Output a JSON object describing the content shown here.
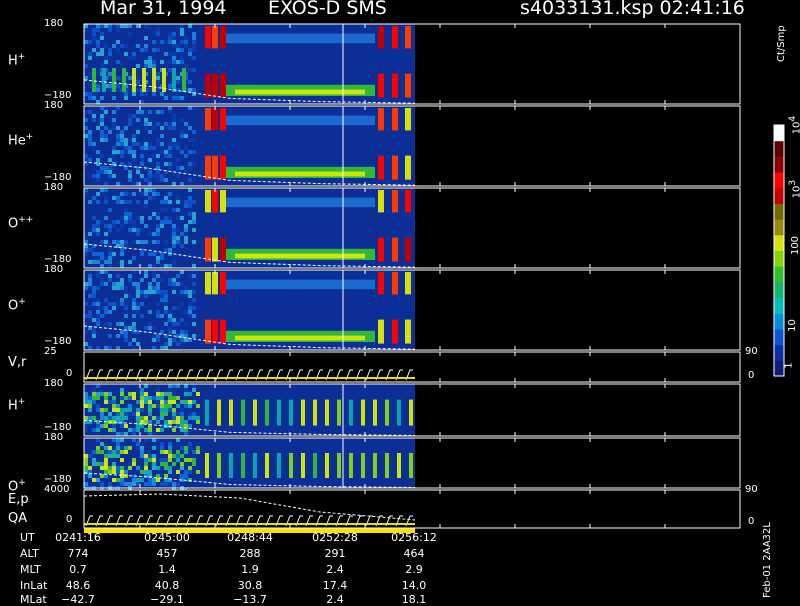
{
  "header": {
    "date": "Mar 31, 1994",
    "mission": "EXOS-D SMS",
    "file_time": "s4033131.ksp  02:41:16"
  },
  "colorbar": {
    "label": "Ct/Smp",
    "ticks": [
      "1",
      "10",
      "100",
      "10",
      "10"
    ],
    "tick_sups": [
      "",
      "",
      "",
      "3",
      "4"
    ],
    "colors": [
      "#0b1f7a",
      "#0c2fa6",
      "#0b55d3",
      "#0090d8",
      "#00c0c0",
      "#14b46e",
      "#2fc02c",
      "#86d40e",
      "#d6e40b",
      "#9a8a08",
      "#6f6a06",
      "#c00000",
      "#ff0000",
      "#8a0000",
      "#5a0000",
      "#ffffff"
    ]
  },
  "footer": {
    "stamp": "Feb-01 2AA32L"
  },
  "panels": [
    {
      "label": "H",
      "sup": "+",
      "ymax": "180",
      "ymin": "−180"
    },
    {
      "label": "He",
      "sup": "+",
      "ymax": "180",
      "ymin": "−180"
    },
    {
      "label": "O",
      "sup": "++",
      "ymax": "180",
      "ymin": "−180"
    },
    {
      "label": "O",
      "sup": "+",
      "ymax": "180",
      "ymin": "−180"
    },
    {
      "label": "V,r",
      "sup": "",
      "ymax": "25",
      "ymin": "0",
      "right_top": "90",
      "right_bot": "0"
    },
    {
      "label": "H",
      "sup": "+",
      "ymax": "180",
      "ymin": "−180"
    },
    {
      "label": "O",
      "sup": "+",
      "ymax": "180",
      "ymin": "−180"
    },
    {
      "label": "E,p",
      "label2": "QA",
      "sup": "",
      "ymax": "4000",
      "ymin": "0",
      "right_top": "90",
      "right_bot": "0"
    }
  ],
  "info_table": {
    "row_labels": [
      "UT",
      "ALT",
      "MLT",
      "InLat",
      "MLat"
    ],
    "columns": [
      [
        "0241:16",
        "774",
        "0.7",
        "48.6",
        "−42.7"
      ],
      [
        "0245:00",
        "457",
        "1.4",
        "40.8",
        "−29.1"
      ],
      [
        "0248:44",
        "288",
        "1.9",
        "30.8",
        "−13.7"
      ],
      [
        "0252:28",
        "291",
        "2.4",
        "17.4",
        "2.4"
      ],
      [
        "0256:12",
        "464",
        "2.9",
        "14.0",
        "18.1"
      ]
    ]
  },
  "chart_data": {
    "type": "heatmap",
    "x_ticks_ut": [
      "0241:16",
      "0245:00",
      "0248:44",
      "0252:28",
      "0256:12"
    ],
    "colorbar_scale": "log",
    "colorbar_range": [
      1,
      10000
    ],
    "panels": [
      {
        "name": "H+",
        "yrange": [
          -180,
          180
        ]
      },
      {
        "name": "He+",
        "yrange": [
          -180,
          180
        ]
      },
      {
        "name": "O++",
        "yrange": [
          -180,
          180
        ]
      },
      {
        "name": "O+",
        "yrange": [
          -180,
          180
        ]
      },
      {
        "name": "V,r",
        "yrange": [
          0,
          25
        ],
        "y2range": [
          0,
          90
        ]
      },
      {
        "name": "H+",
        "yrange": [
          -180,
          180
        ]
      },
      {
        "name": "O+",
        "yrange": [
          -180,
          180
        ]
      },
      {
        "name": "E,p QA",
        "yrange": [
          0,
          4000
        ],
        "y2range": [
          0,
          90
        ]
      }
    ]
  }
}
